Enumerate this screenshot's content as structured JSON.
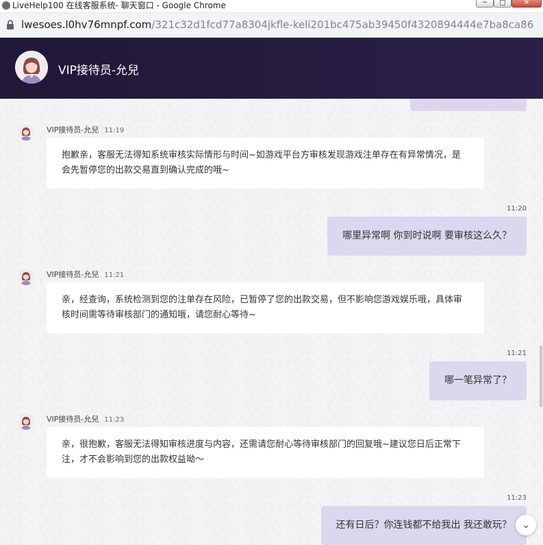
{
  "window": {
    "title": "LiveHelp100 在线客服系统- 聊天窗口 - Google Chrome",
    "minimize_glyph": "─",
    "maximize_glyph": "□",
    "close_glyph": "✕"
  },
  "address": {
    "host": "lwesoes.l0hv76mnpf.com",
    "path": "/321c32d1fcd77a8304jkfle-keli201bc475ab39450f4320894444e7ba8ca86116835bb65..."
  },
  "header": {
    "agent_title": "VIP接待员-允兒"
  },
  "messages": [
    {
      "sender": "agent",
      "name": "VIP接待员-允兒",
      "time": "11:19",
      "text": "抱歉亲，客服无法得知系统审核实际情形与时间~如游戏平台方审核发现游戏注单存在有异常情况，是会先暂停您的出款交易直到确认完成的哦~"
    },
    {
      "sender": "user",
      "time": "11:20",
      "text": "哪里异常啊 你到时说啊 要审核这么久？"
    },
    {
      "sender": "agent",
      "name": "VIP接待员-允兒",
      "time": "11:21",
      "text": "亲，经查询，系统检测到您的注单存在风险，已暂停了您的出款交易，但不影响您游戏娱乐哦，具体审核时间需等待审核部门的通知哦，请您耐心等待~"
    },
    {
      "sender": "user",
      "time": "11:21",
      "text": "哪一笔异常了？"
    },
    {
      "sender": "agent",
      "name": "VIP接待员-允兒",
      "time": "11:23",
      "text": "亲，很抱歉，客服无法得知审核进度与内容，还需请您耐心等待审核部门的回复哦~建议您日后正常下注，才不会影响到您的出款权益呦～"
    },
    {
      "sender": "user",
      "time": "11:23",
      "text": "还有日后？你连钱都不给我出 我还敢玩？"
    }
  ],
  "controls": {
    "scroll_bottom_glyph": "⌄"
  },
  "colors": {
    "header_bg": "#211838",
    "user_bubble": "#dcd7ee",
    "agent_bubble": "#ffffff"
  }
}
